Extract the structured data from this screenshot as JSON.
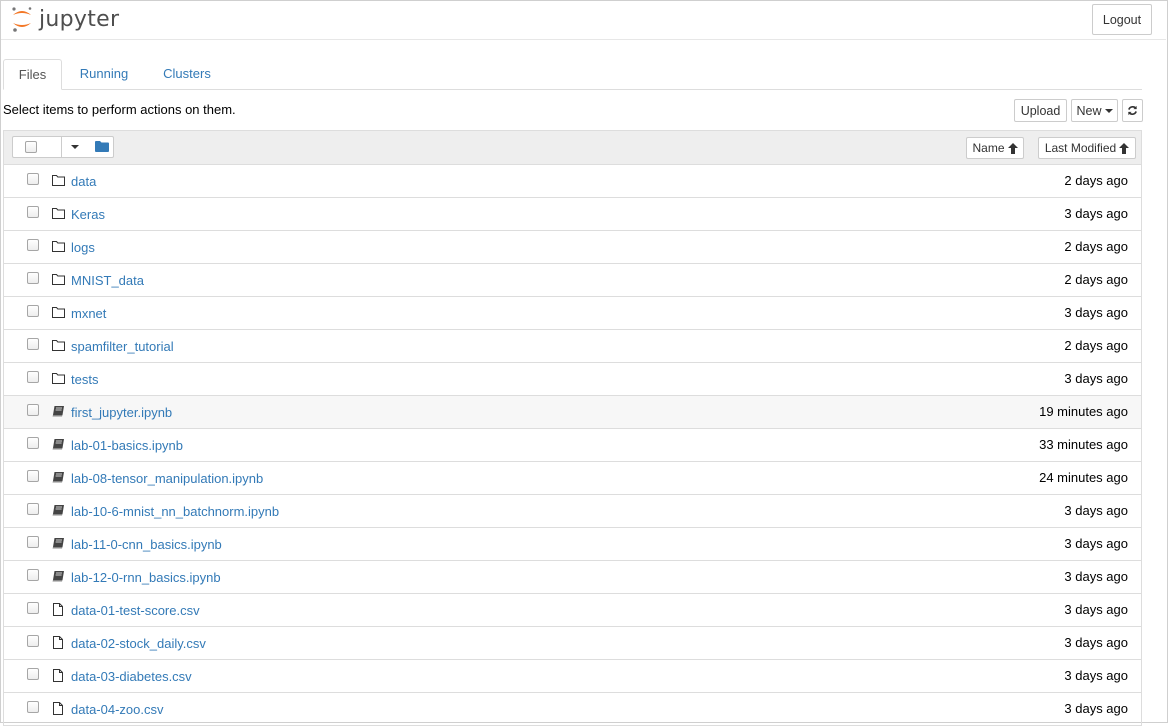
{
  "header": {
    "app_name": "jupyter",
    "logout_label": "Logout"
  },
  "tabs": [
    {
      "label": "Files",
      "active": true
    },
    {
      "label": "Running",
      "active": false
    },
    {
      "label": "Clusters",
      "active": false
    }
  ],
  "toolbar": {
    "instructions": "Select items to perform actions on them.",
    "upload_label": "Upload",
    "new_label": "New",
    "refresh_icon": "refresh-icon"
  },
  "list_header": {
    "sort_name_label": "Name",
    "sort_modified_label": "Last Modified"
  },
  "files": [
    {
      "name": "data",
      "type": "folder",
      "modified": "2 days ago"
    },
    {
      "name": "Keras",
      "type": "folder",
      "modified": "3 days ago"
    },
    {
      "name": "logs",
      "type": "folder",
      "modified": "2 days ago"
    },
    {
      "name": "MNIST_data",
      "type": "folder",
      "modified": "2 days ago"
    },
    {
      "name": "mxnet",
      "type": "folder",
      "modified": "3 days ago"
    },
    {
      "name": "spamfilter_tutorial",
      "type": "folder",
      "modified": "2 days ago"
    },
    {
      "name": "tests",
      "type": "folder",
      "modified": "3 days ago"
    },
    {
      "name": "first_jupyter.ipynb",
      "type": "notebook",
      "modified": "19 minutes ago",
      "highlighted": true
    },
    {
      "name": "lab-01-basics.ipynb",
      "type": "notebook",
      "modified": "33 minutes ago"
    },
    {
      "name": "lab-08-tensor_manipulation.ipynb",
      "type": "notebook",
      "modified": "24 minutes ago"
    },
    {
      "name": "lab-10-6-mnist_nn_batchnorm.ipynb",
      "type": "notebook",
      "modified": "3 days ago"
    },
    {
      "name": "lab-11-0-cnn_basics.ipynb",
      "type": "notebook",
      "modified": "3 days ago"
    },
    {
      "name": "lab-12-0-rnn_basics.ipynb",
      "type": "notebook",
      "modified": "3 days ago"
    },
    {
      "name": "data-01-test-score.csv",
      "type": "file",
      "modified": "3 days ago"
    },
    {
      "name": "data-02-stock_daily.csv",
      "type": "file",
      "modified": "3 days ago"
    },
    {
      "name": "data-03-diabetes.csv",
      "type": "file",
      "modified": "3 days ago"
    },
    {
      "name": "data-04-zoo.csv",
      "type": "file",
      "modified": "3 days ago"
    }
  ],
  "colors": {
    "link": "#337ab7",
    "logo_orange": "#f37726",
    "logo_gray": "#767677"
  }
}
